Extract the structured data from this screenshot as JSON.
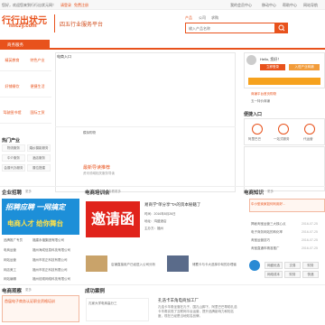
{
  "topbar": {
    "welcome": "您好，欢迎您来到行行出状元网！",
    "links": [
      "请登录",
      "免费注册"
    ],
    "right_links": [
      "我的会员中心",
      "移动中心",
      "帮助中心",
      "网站导航"
    ]
  },
  "logo": {
    "main": "行行出状元",
    "domain": "hhczy.com",
    "slogan": "四五行业服务平台"
  },
  "search": {
    "tabs": [
      "产品",
      "公司",
      "求购"
    ],
    "placeholder": "输入产品名称"
  },
  "nav": {
    "first": "商务服务",
    "items": []
  },
  "left_grid": [
    "精英教育",
    "特色产业",
    "好铺餐饮",
    "便捷生活",
    "驾驶图书馆",
    "国际工贸"
  ],
  "hot": {
    "title": "热门产业",
    "tags": [
      "物流服务",
      "婚纱摄影服务",
      "中介服务",
      "酒店服务",
      "会展代办服务",
      "展位搭建"
    ]
  },
  "main": {
    "label_top": "电商入口",
    "label_mid": "模拟购物",
    "highlight_text": "最新导读推荐",
    "highlight_sub": "资讯领域相关服务导读"
  },
  "right": {
    "greeting": "Hello, 您好！",
    "login_btn": "立即登录",
    "register_btn": "入驻产业商铺",
    "links": [
      "商铺平台首页购物",
      "五一特价商铺"
    ],
    "entry_title": "便捷入口",
    "entries": [
      "阿里巴巴",
      "一站式服务",
      "代运营"
    ]
  },
  "recruit": {
    "title": "企业招聘",
    "more": "更多",
    "banner_line1": "招聘应聘 一网搞定",
    "banner_line2": "电商人才 给你舞台",
    "rows": [
      [
        "品牌推广专员",
        "福建永福集团有限公司"
      ],
      [
        "电商运营",
        "福州海成信息科技有限公司"
      ],
      [
        "网站运营",
        "福州市钦正科技有限公司"
      ],
      [
        "网店美工",
        "福州市钦正科技有限公司"
      ],
      [
        "网站编辑",
        "福州炫硕网络科技有限公司"
      ]
    ]
  },
  "training": {
    "title": "电商培训会",
    "more": "查看更多",
    "invite_text": "邀请函",
    "card_title": "易商学“单分享”TA的资本秘籍了",
    "card_lines": [
      "时间：2016年8月26日",
      "地址：鸿盛酒店",
      "主办方：福州"
    ],
    "news": [
      "店铺直接用户已经进入公司分析",
      "储蓄卡与卡大选择中旬的办理者"
    ]
  },
  "knowledge": {
    "title": "电商知识",
    "more": "更多",
    "featured": "中小型卖家如何利用好...",
    "rows": [
      "揭秘淘宝运营三大核心点",
      "电子商务网站的转化率",
      "淘宝运营技巧",
      "淘宝直通车精准推广"
    ],
    "dates": [
      "2016-07-25",
      "2016-07-25",
      "2016-07-25",
      "2016-07-25"
    ]
  },
  "tools": {
    "rows": [
      [
        "网盛优选",
        "交易",
        "财务"
      ],
      [
        "网络成本",
        "财务",
        "快递"
      ]
    ]
  },
  "promo": {
    "title": "电商观察",
    "more": "更多",
    "text": "首届电子商务认证职业资格培训"
  },
  "cases": {
    "title": "成功案例",
    "item_title": "孔家大学电商高分三",
    "item2_title": "孔浩卡羊角电商加工厂",
    "item2_text": "孔浩卡羊角坐落在孔子、国孔山脚下，阿里巴巴帮助孔浩卡羊角实现了互联网平台运营，提升品牌影响力和知名度，现在已经是当地知名品牌。"
  }
}
